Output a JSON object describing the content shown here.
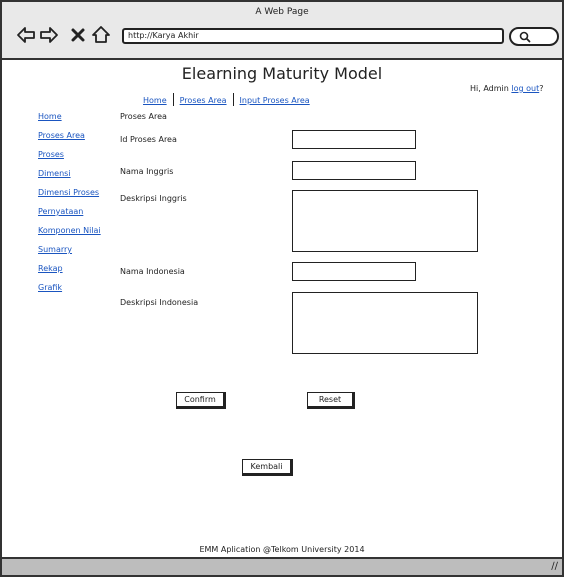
{
  "browser": {
    "window_title": "A Web Page",
    "url": "http://Karya Akhir"
  },
  "page": {
    "title": "Elearning Maturity Model",
    "greeting_prefix": "Hi, Admin ",
    "logout_label": "log out",
    "greeting_suffix": "?"
  },
  "breadcrumb": {
    "items": [
      "Home",
      "Proses Area",
      "Input Proses Area"
    ]
  },
  "sidebar": {
    "items": [
      "Home",
      "Proses Area",
      "Proses",
      "Dimensi",
      "Dimensi Proses",
      "Pernyataan",
      "Komponen Nilai",
      "Sumarry",
      "Rekap",
      "Grafik"
    ]
  },
  "form": {
    "section_title": "Proses Area",
    "id_label": "Id Proses Area",
    "nama_inggris_label": "Nama Inggris",
    "deskripsi_inggris_label": "Deskripsi Inggris",
    "nama_indonesia_label": "Nama Indonesia",
    "deskripsi_indonesia_label": "Deskripsi Indonesia"
  },
  "buttons": {
    "confirm": "Confirm",
    "reset": "Reset",
    "back": "Kembali"
  },
  "footer": {
    "text": "EMM Aplication @Telkom University 2014"
  }
}
